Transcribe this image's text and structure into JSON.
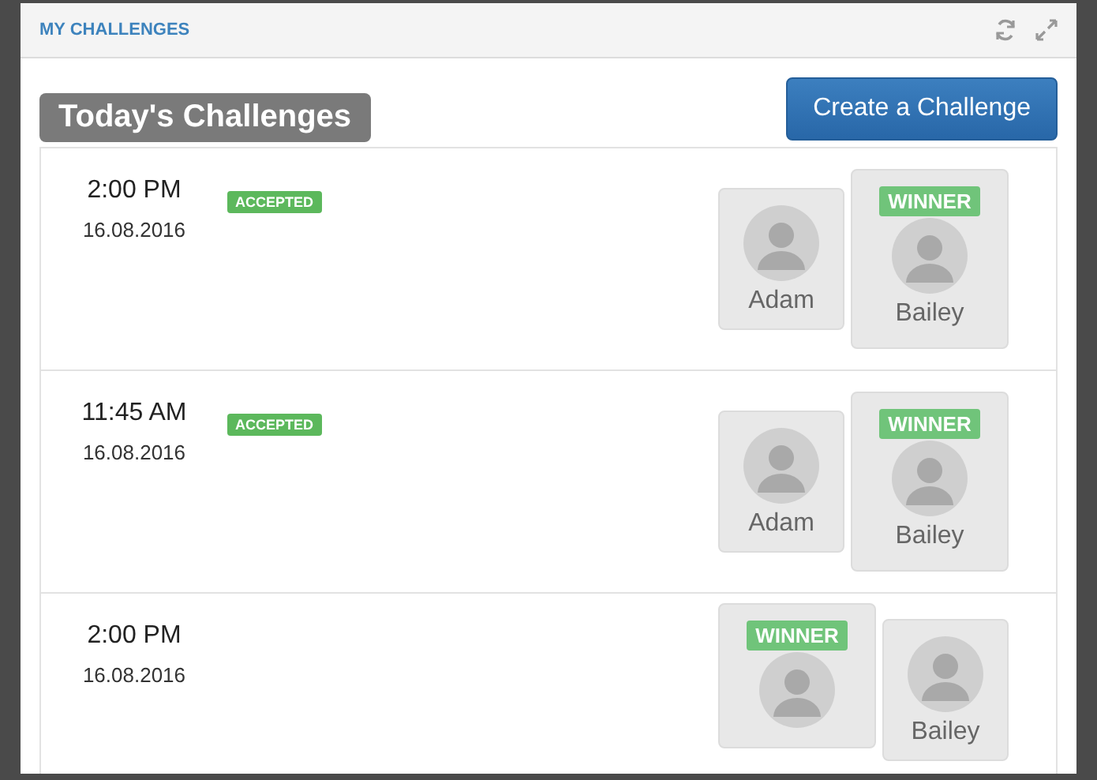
{
  "panel": {
    "title": "MY CHALLENGES"
  },
  "heading": "Today's Challenges",
  "create_button": "Create a Challenge",
  "challenges": [
    {
      "time": "2:00 PM",
      "date": "16.08.2016",
      "status": "ACCEPTED",
      "players": [
        {
          "name": "Adam"
        },
        {
          "name": "Bailey",
          "winner_badge": "WINNER"
        }
      ]
    },
    {
      "time": "11:45 AM",
      "date": "16.08.2016",
      "status": "ACCEPTED",
      "players": [
        {
          "name": "Adam"
        },
        {
          "name": "Bailey",
          "winner_badge": "WINNER"
        }
      ]
    },
    {
      "time": "2:00 PM",
      "date": "16.08.2016",
      "players": [
        {
          "winner_badge": "WINNER"
        },
        {
          "name": "Bailey"
        }
      ]
    }
  ]
}
